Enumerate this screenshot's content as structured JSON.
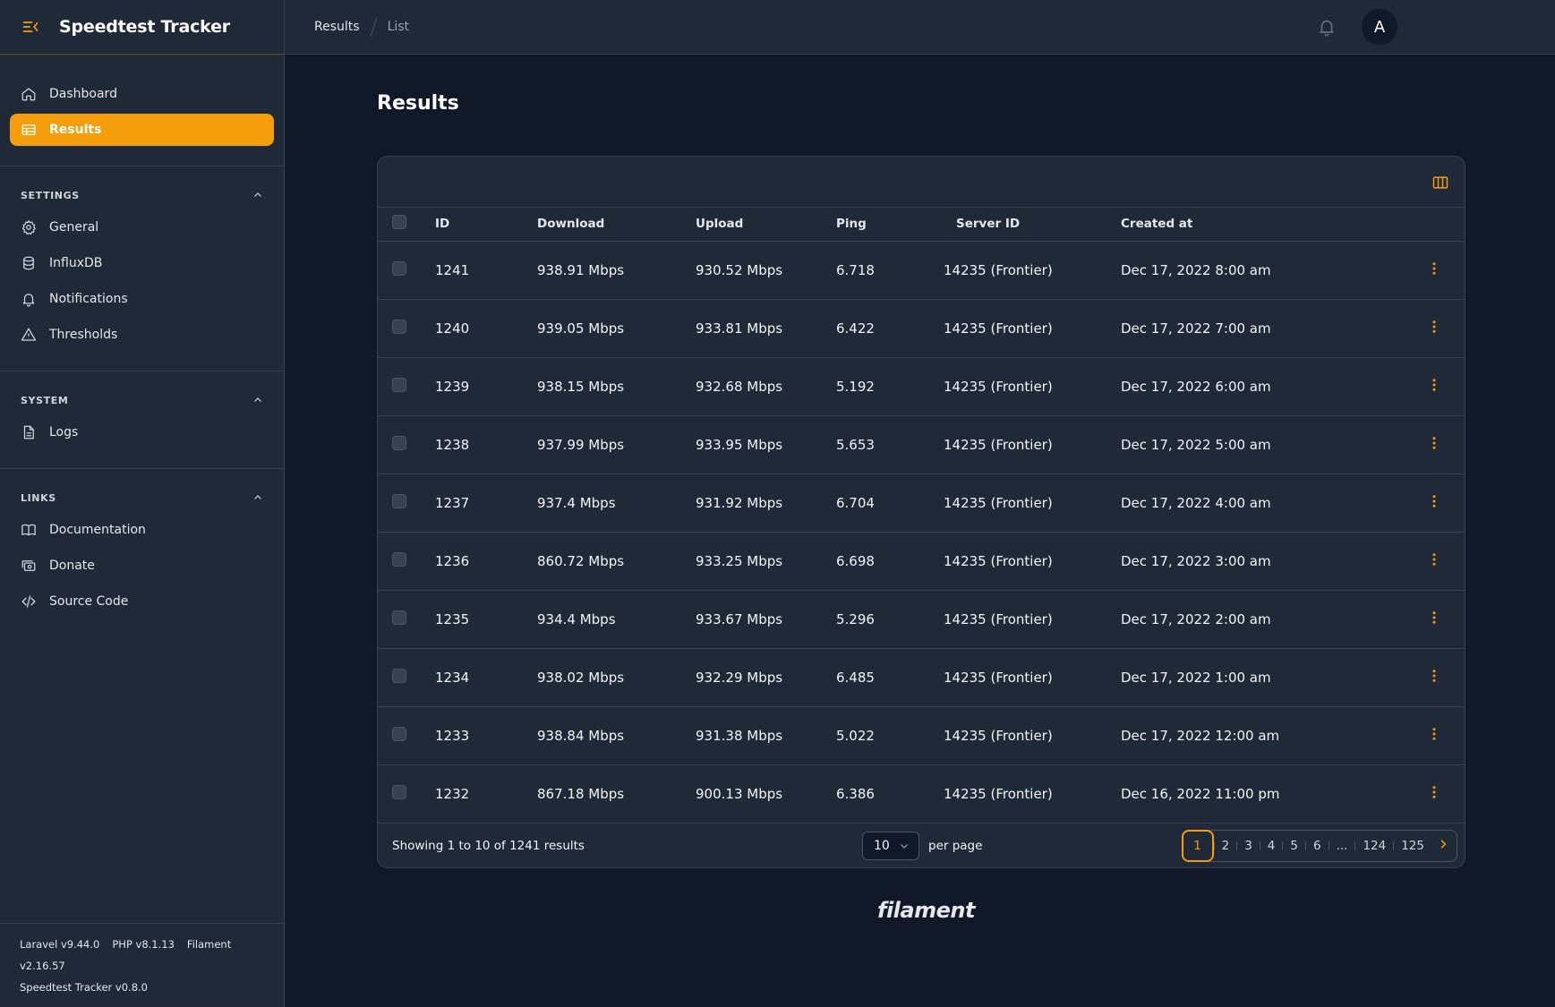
{
  "brand": {
    "title": "Speedtest Tracker"
  },
  "nav": {
    "items": [
      {
        "label": "Dashboard"
      },
      {
        "label": "Results"
      }
    ]
  },
  "groups": {
    "settings": {
      "title": "SETTINGS",
      "items": [
        {
          "label": "General"
        },
        {
          "label": "InfluxDB"
        },
        {
          "label": "Notifications"
        },
        {
          "label": "Thresholds"
        }
      ]
    },
    "system": {
      "title": "SYSTEM",
      "items": [
        {
          "label": "Logs"
        }
      ]
    },
    "links": {
      "title": "LINKS",
      "items": [
        {
          "label": "Documentation"
        },
        {
          "label": "Donate"
        },
        {
          "label": "Source Code"
        }
      ]
    }
  },
  "versions": {
    "laravel": "Laravel v9.44.0",
    "php": "PHP v8.1.13",
    "filament": "Filament v2.16.57",
    "app": "Speedtest Tracker v0.8.0"
  },
  "breadcrumb": {
    "first": "Results",
    "second": "List"
  },
  "user": {
    "initial": "A"
  },
  "page": {
    "title": "Results"
  },
  "table": {
    "columns": {
      "id": "ID",
      "download": "Download",
      "upload": "Upload",
      "ping": "Ping",
      "server": "Server ID",
      "created": "Created at"
    },
    "rows": [
      {
        "id": "1241",
        "download": "938.91 Mbps",
        "upload": "930.52 Mbps",
        "ping": "6.718",
        "server": "14235 (Frontier)",
        "created": "Dec 17, 2022 8:00 am"
      },
      {
        "id": "1240",
        "download": "939.05 Mbps",
        "upload": "933.81 Mbps",
        "ping": "6.422",
        "server": "14235 (Frontier)",
        "created": "Dec 17, 2022 7:00 am"
      },
      {
        "id": "1239",
        "download": "938.15 Mbps",
        "upload": "932.68 Mbps",
        "ping": "5.192",
        "server": "14235 (Frontier)",
        "created": "Dec 17, 2022 6:00 am"
      },
      {
        "id": "1238",
        "download": "937.99 Mbps",
        "upload": "933.95 Mbps",
        "ping": "5.653",
        "server": "14235 (Frontier)",
        "created": "Dec 17, 2022 5:00 am"
      },
      {
        "id": "1237",
        "download": "937.4 Mbps",
        "upload": "931.92 Mbps",
        "ping": "6.704",
        "server": "14235 (Frontier)",
        "created": "Dec 17, 2022 4:00 am"
      },
      {
        "id": "1236",
        "download": "860.72 Mbps",
        "upload": "933.25 Mbps",
        "ping": "6.698",
        "server": "14235 (Frontier)",
        "created": "Dec 17, 2022 3:00 am"
      },
      {
        "id": "1235",
        "download": "934.4 Mbps",
        "upload": "933.67 Mbps",
        "ping": "5.296",
        "server": "14235 (Frontier)",
        "created": "Dec 17, 2022 2:00 am"
      },
      {
        "id": "1234",
        "download": "938.02 Mbps",
        "upload": "932.29 Mbps",
        "ping": "6.485",
        "server": "14235 (Frontier)",
        "created": "Dec 17, 2022 1:00 am"
      },
      {
        "id": "1233",
        "download": "938.84 Mbps",
        "upload": "931.38 Mbps",
        "ping": "5.022",
        "server": "14235 (Frontier)",
        "created": "Dec 17, 2022 12:00 am"
      },
      {
        "id": "1232",
        "download": "867.18 Mbps",
        "upload": "900.13 Mbps",
        "ping": "6.386",
        "server": "14235 (Frontier)",
        "created": "Dec 16, 2022 11:00 pm"
      }
    ]
  },
  "footer": {
    "summary": "Showing 1 to 10 of 1241 results",
    "per_page_value": "10",
    "per_page_label": "per page",
    "pages": [
      "1",
      "2",
      "3",
      "4",
      "5",
      "6",
      "...",
      "124",
      "125"
    ]
  },
  "powered_by": "filament",
  "colors": {
    "accent": "#f59e0b",
    "background": "#111827",
    "panel": "#1f2937",
    "border": "#374151"
  },
  "icons": {
    "brand": "menu-collapse-icon",
    "nav": [
      "home-icon",
      "table-icon"
    ],
    "settings": [
      "cog-icon",
      "database-icon",
      "bell-icon",
      "warning-icon"
    ],
    "system": [
      "document-icon"
    ],
    "links": [
      "book-icon",
      "cash-icon",
      "code-icon"
    ]
  }
}
